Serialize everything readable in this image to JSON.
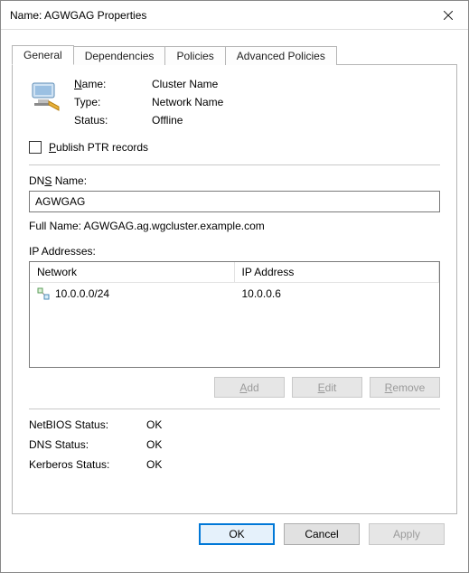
{
  "window": {
    "title": "Name: AGWGAG Properties"
  },
  "tabs": [
    {
      "label": "General"
    },
    {
      "label": "Dependencies"
    },
    {
      "label": "Policies"
    },
    {
      "label": "Advanced Policies"
    }
  ],
  "general": {
    "name_label": "Name:",
    "name_value": "Cluster Name",
    "type_label": "Type:",
    "type_value": "Network Name",
    "status_label": "Status:",
    "status_value": "Offline",
    "publish_ptr_label": "Publish PTR records",
    "dns_name_label": "DNS Name:",
    "dns_name_value": "AGWGAG",
    "full_name_label": "Full Name: AGWGAG.ag.wgcluster.example.com",
    "ip_addresses_label": "IP Addresses:",
    "ip_table": {
      "col_network": "Network",
      "col_ip": "IP Address",
      "rows": [
        {
          "network": "10.0.0.0/24",
          "ip": "10.0.0.6"
        }
      ]
    },
    "buttons": {
      "add": "Add",
      "edit": "Edit",
      "remove": "Remove"
    },
    "netbios_label": "NetBIOS Status:",
    "netbios_value": "OK",
    "dnsstat_label": "DNS Status:",
    "dnsstat_value": "OK",
    "kerberos_label": "Kerberos Status:",
    "kerberos_value": "OK"
  },
  "dialog_buttons": {
    "ok": "OK",
    "cancel": "Cancel",
    "apply": "Apply"
  }
}
